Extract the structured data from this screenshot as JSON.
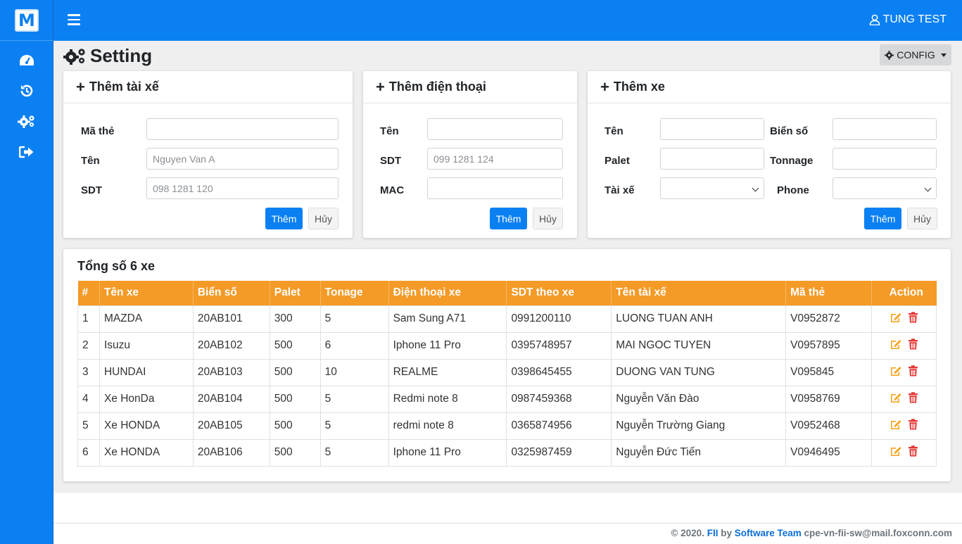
{
  "brand": {
    "letter": "M"
  },
  "header": {
    "user_name": "TUNG TEST"
  },
  "sidebar": {
    "items": [
      {
        "name": "dashboard-icon"
      },
      {
        "name": "history-icon"
      },
      {
        "name": "settings-icon"
      },
      {
        "name": "logout-icon"
      }
    ]
  },
  "page": {
    "title": "Setting",
    "config_label": "CONFIG"
  },
  "driver_form": {
    "title": "Thêm tài xế",
    "card_label": "Mã thẻ",
    "name_label": "Tên",
    "name_placeholder": "Nguyen Van A",
    "phone_label": "SDT",
    "phone_placeholder": "098 1281 120",
    "add_label": "Thêm",
    "cancel_label": "Hủy"
  },
  "phone_form": {
    "title": "Thêm điện thoại",
    "name_label": "Tên",
    "phone_label": "SDT",
    "phone_placeholder": "099 1281 124",
    "mac_label": "MAC",
    "add_label": "Thêm",
    "cancel_label": "Hủy"
  },
  "car_form": {
    "title": "Thêm xe",
    "name_label": "Tên",
    "plate_label": "Biển số",
    "palet_label": "Palet",
    "tonnage_label": "Tonnage",
    "driver_label": "Tài xế",
    "phone_label": "Phone",
    "add_label": "Thêm",
    "cancel_label": "Hủy"
  },
  "table": {
    "title": "Tổng số 6 xe",
    "headers": [
      "#",
      "Tên xe",
      "Biển số",
      "Palet",
      "Tonage",
      "Điện thoại xe",
      "SDT theo xe",
      "Tên tài xế",
      "Mã thẻ",
      "Action"
    ],
    "rows": [
      [
        "1",
        "MAZDA",
        "20AB101",
        "300",
        "5",
        "Sam Sung A71",
        "0991200110",
        "LUONG TUAN ANH",
        "V0952872"
      ],
      [
        "2",
        "Isuzu",
        "20AB102",
        "500",
        "6",
        "Iphone 11 Pro",
        "0395748957",
        "MAI NGOC TUYEN",
        "V0957895"
      ],
      [
        "3",
        "HUNDAI",
        "20AB103",
        "500",
        "10",
        "REALME",
        "0398645455",
        "DUONG VAN TUNG",
        "V095845"
      ],
      [
        "4",
        "Xe HonDa",
        "20AB104",
        "500",
        "5",
        "Redmi note 8",
        "0987459368",
        "Nguyễn Văn Đào",
        "V0958769"
      ],
      [
        "5",
        "Xe HONDA",
        "20AB105",
        "500",
        "5",
        "redmi note 8",
        "0365874956",
        "Nguyễn Trường Giang",
        "V0952468"
      ],
      [
        "6",
        "Xe HONDA",
        "20AB106",
        "500",
        "5",
        "Iphone 11 Pro",
        "0325987459",
        "Nguyễn Đức Tiến",
        "V0946495"
      ]
    ]
  },
  "footer": {
    "prefix": "© 2020.",
    "company": "FII",
    "by": "by",
    "team": "Software Team",
    "email": "cpe-vn-fii-sw@mail.foxconn.com"
  },
  "colors": {
    "primary": "#0b80f3",
    "table_header": "#f49a27",
    "edit": "#f5a623",
    "delete": "#e53935"
  }
}
